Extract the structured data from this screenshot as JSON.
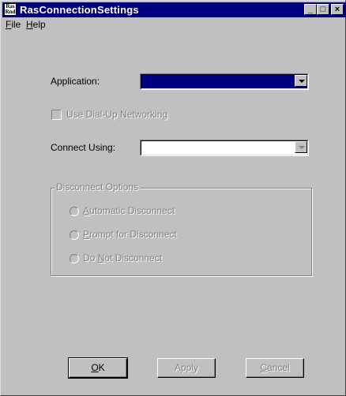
{
  "window": {
    "title": "RasConnectionSettings",
    "icon_text": "Ras Rnd",
    "controls": {
      "minimize": "_",
      "maximize": "□",
      "close": "×"
    }
  },
  "menu": {
    "file": {
      "accel": "F",
      "rest": "ile"
    },
    "help": {
      "accel": "H",
      "rest": "elp"
    }
  },
  "form": {
    "application_label": "Application:",
    "application_value": "",
    "dialup_label": "Use Dial-Up Networking",
    "dialup_checked": false,
    "connect_using_label": "Connect Using:",
    "connect_using_value": ""
  },
  "disconnect": {
    "legend": "Disconnect Options",
    "auto": {
      "accel": "A",
      "rest": "utomatic Disconnect"
    },
    "prompt": {
      "accel": "P",
      "rest": "rompt for Disconnect"
    },
    "none": {
      "pre": "Do ",
      "accel": "N",
      "rest": "ot Disconnect"
    }
  },
  "buttons": {
    "ok": {
      "accel": "O",
      "rest": "K"
    },
    "apply": "Apply",
    "cancel": {
      "accel": "C",
      "rest": "ancel"
    }
  },
  "colors": {
    "face": "#c0c0c0",
    "titlebar": "#000080",
    "selection": "#000080",
    "disabled_text": "#808080"
  }
}
